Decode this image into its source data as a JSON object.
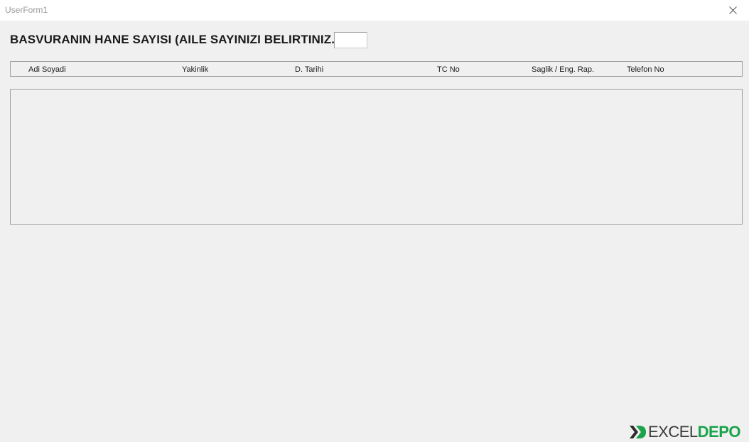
{
  "window": {
    "title": "UserForm1",
    "close_icon": "close-icon"
  },
  "form": {
    "heading": "BASVURANIN HANE SAYISI (AILE SAYINIZI BELIRTINIZ.)",
    "household_count_value": ""
  },
  "columns": [
    {
      "label": "Adi Soyadi"
    },
    {
      "label": "Yakinlik"
    },
    {
      "label": "D. Tarihi"
    },
    {
      "label": "TC No"
    },
    {
      "label": "Saglik / Eng. Rap."
    },
    {
      "label": "Telefon No"
    }
  ],
  "list": {
    "rows": []
  },
  "watermark": {
    "part1": "EXCEL",
    "part2": "DEPO",
    "colors": {
      "part1": "#3a3a3a",
      "part2": "#1aa34a"
    }
  }
}
